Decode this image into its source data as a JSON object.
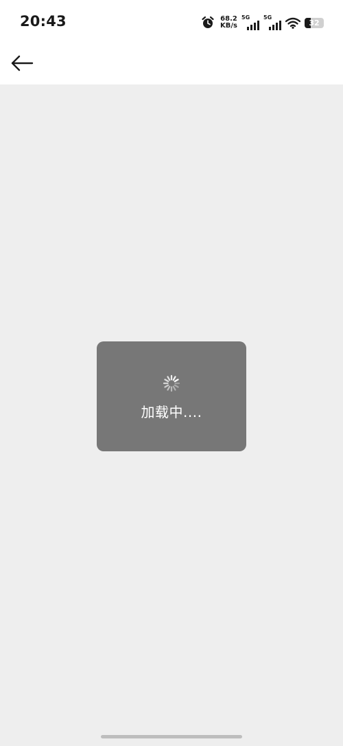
{
  "status_bar": {
    "time": "20:43",
    "net_speed_value": "68.2",
    "net_speed_unit": "KB/s",
    "sim1_label": "5G",
    "sim2_label": "5G",
    "battery_level": "32",
    "icons": [
      "alarm-icon",
      "signal-icon",
      "signal-icon",
      "wifi-icon",
      "battery-icon"
    ]
  },
  "app_bar": {
    "back_icon": "arrow-left-icon"
  },
  "loading": {
    "text": "加载中....",
    "icon": "spinner-icon"
  },
  "colors": {
    "background": "#eeeeee",
    "header": "#ffffff",
    "dialog": "#777777",
    "dialog_text": "#ffffff",
    "home_indicator": "#bdbdbd"
  }
}
